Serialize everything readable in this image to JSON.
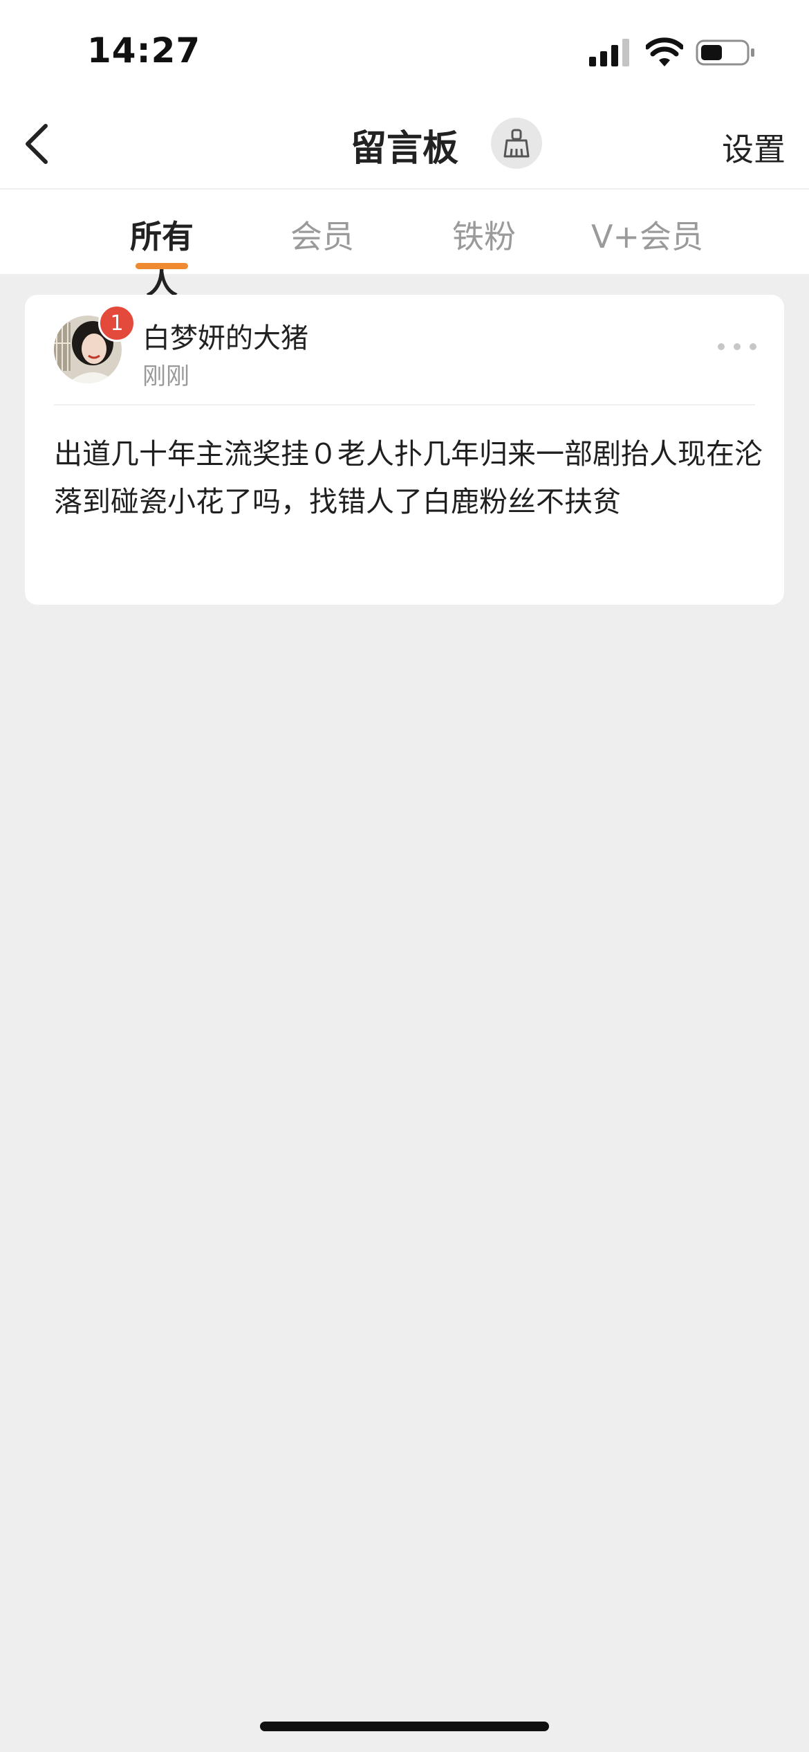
{
  "status_bar": {
    "time": "14:27"
  },
  "nav": {
    "title": "留言板",
    "settings_label": "设置",
    "icons": {
      "back": "back-chevron-icon",
      "clean": "broom-icon"
    }
  },
  "tabs": [
    {
      "label": "所有人",
      "active": true
    },
    {
      "label": "会员",
      "active": false
    },
    {
      "label": "铁粉",
      "active": false
    },
    {
      "label": "V+会员",
      "active": false
    }
  ],
  "colors": {
    "accent": "#f08a30",
    "badge": "#e34a3c",
    "background": "#eeeeee"
  },
  "messages": [
    {
      "username": "白梦妍的大猪",
      "time": "刚刚",
      "badge_count": "1",
      "text": "出道几十年主流奖挂０老人扑几年归来一部剧抬人现在沦落到碰瓷小花了吗，找错人了白鹿粉丝不扶贫"
    }
  ]
}
